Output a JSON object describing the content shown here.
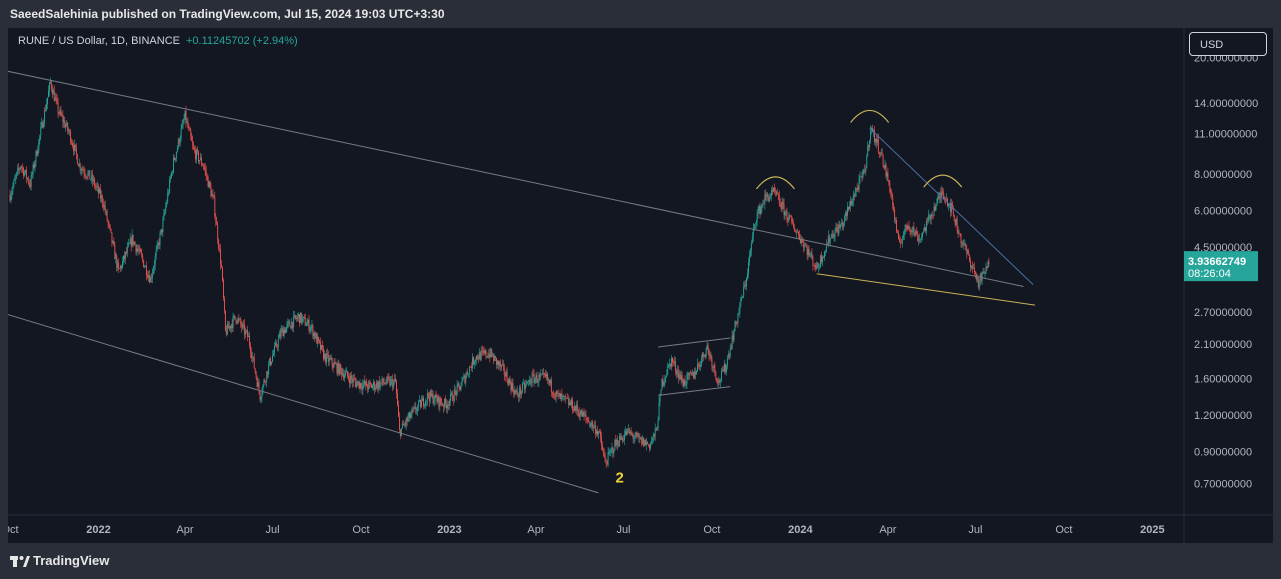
{
  "header": {
    "published_by": "SaeedSalehinia published on TradingView.com, Jul 15, 2024 19:03 UTC+3:30"
  },
  "legend": {
    "symbol": "RUNE / US Dollar, 1D, BINANCE",
    "change": "+0.11245702 (+2.94%)"
  },
  "currency_button": "USD",
  "footer": {
    "brand": "TradingView"
  },
  "chart_data": {
    "type": "candlestick",
    "symbol": "RUNE / US Dollar",
    "interval": "1D",
    "exchange": "BINANCE",
    "y_scale": "log",
    "ylim": [
      0.6,
      23
    ],
    "y_ticks": [
      {
        "value": 20,
        "label": "20.00000000"
      },
      {
        "value": 14,
        "label": "14.00000000"
      },
      {
        "value": 11,
        "label": "11.00000000"
      },
      {
        "value": 8,
        "label": "8.00000000"
      },
      {
        "value": 6,
        "label": "6.00000000"
      },
      {
        "value": 4.5,
        "label": "4.50000000"
      },
      {
        "value": 2.7,
        "label": "2.70000000"
      },
      {
        "value": 2.1,
        "label": "2.10000000"
      },
      {
        "value": 1.6,
        "label": "1.60000000"
      },
      {
        "value": 1.2,
        "label": "1.20000000"
      },
      {
        "value": 0.9,
        "label": "0.90000000"
      },
      {
        "value": 0.7,
        "label": "0.70000000"
      }
    ],
    "x_ticks": [
      {
        "date": "2021-10-01",
        "label": "Oct",
        "bold": false
      },
      {
        "date": "2022-01-01",
        "label": "2022",
        "bold": true
      },
      {
        "date": "2022-04-01",
        "label": "Apr",
        "bold": false
      },
      {
        "date": "2022-07-01",
        "label": "Jul",
        "bold": false
      },
      {
        "date": "2022-10-01",
        "label": "Oct",
        "bold": false
      },
      {
        "date": "2023-01-01",
        "label": "2023",
        "bold": true
      },
      {
        "date": "2023-04-01",
        "label": "Apr",
        "bold": false
      },
      {
        "date": "2023-07-01",
        "label": "Jul",
        "bold": false
      },
      {
        "date": "2023-10-01",
        "label": "Oct",
        "bold": false
      },
      {
        "date": "2024-01-01",
        "label": "2024",
        "bold": true
      },
      {
        "date": "2024-04-01",
        "label": "Apr",
        "bold": false
      },
      {
        "date": "2024-07-01",
        "label": "Jul",
        "bold": false
      },
      {
        "date": "2024-10-01",
        "label": "Oct",
        "bold": false
      },
      {
        "date": "2025-01-01",
        "label": "2025",
        "bold": true
      }
    ],
    "x_range": [
      "2021-10-01",
      "2025-02-05"
    ],
    "price_path": [
      [
        "2021-10-01",
        6.8
      ],
      [
        "2021-10-12",
        8.6
      ],
      [
        "2021-10-22",
        7.4
      ],
      [
        "2021-11-06",
        13.0
      ],
      [
        "2021-11-12",
        16.5
      ],
      [
        "2021-11-20",
        13.2
      ],
      [
        "2021-12-02",
        11.0
      ],
      [
        "2021-12-12",
        8.6
      ],
      [
        "2021-12-26",
        7.6
      ],
      [
        "2022-01-06",
        6.4
      ],
      [
        "2022-01-22",
        3.7
      ],
      [
        "2022-02-05",
        4.8
      ],
      [
        "2022-02-14",
        4.2
      ],
      [
        "2022-02-24",
        3.5
      ],
      [
        "2022-03-08",
        5.2
      ],
      [
        "2022-03-20",
        8.8
      ],
      [
        "2022-04-01",
        12.6
      ],
      [
        "2022-04-10",
        9.6
      ],
      [
        "2022-04-20",
        8.6
      ],
      [
        "2022-05-01",
        6.4
      ],
      [
        "2022-05-09",
        3.8
      ],
      [
        "2022-05-13",
        2.3
      ],
      [
        "2022-05-24",
        2.6
      ],
      [
        "2022-06-06",
        2.2
      ],
      [
        "2022-06-18",
        1.4
      ],
      [
        "2022-06-28",
        1.8
      ],
      [
        "2022-07-10",
        2.3
      ],
      [
        "2022-07-28",
        2.6
      ],
      [
        "2022-08-10",
        2.4
      ],
      [
        "2022-08-24",
        1.9
      ],
      [
        "2022-09-10",
        1.7
      ],
      [
        "2022-09-25",
        1.55
      ],
      [
        "2022-10-10",
        1.5
      ],
      [
        "2022-10-25",
        1.55
      ],
      [
        "2022-11-06",
        1.55
      ],
      [
        "2022-11-10",
        1.05
      ],
      [
        "2022-11-22",
        1.2
      ],
      [
        "2022-12-10",
        1.4
      ],
      [
        "2022-12-28",
        1.3
      ],
      [
        "2023-01-12",
        1.5
      ],
      [
        "2023-01-28",
        1.9
      ],
      [
        "2023-02-12",
        1.95
      ],
      [
        "2023-02-26",
        1.7
      ],
      [
        "2023-03-12",
        1.4
      ],
      [
        "2023-03-28",
        1.6
      ],
      [
        "2023-04-12",
        1.6
      ],
      [
        "2023-04-22",
        1.4
      ],
      [
        "2023-05-08",
        1.3
      ],
      [
        "2023-05-25",
        1.15
      ],
      [
        "2023-06-05",
        1.05
      ],
      [
        "2023-06-12",
        0.82
      ],
      [
        "2023-06-22",
        0.95
      ],
      [
        "2023-07-05",
        1.05
      ],
      [
        "2023-07-18",
        0.98
      ],
      [
        "2023-07-28",
        0.95
      ],
      [
        "2023-08-04",
        1.05
      ],
      [
        "2023-08-10",
        1.55
      ],
      [
        "2023-08-20",
        1.85
      ],
      [
        "2023-09-01",
        1.55
      ],
      [
        "2023-09-12",
        1.65
      ],
      [
        "2023-09-26",
        2.05
      ],
      [
        "2023-10-08",
        1.55
      ],
      [
        "2023-10-15",
        1.75
      ],
      [
        "2023-10-25",
        2.4
      ],
      [
        "2023-11-05",
        3.4
      ],
      [
        "2023-11-15",
        5.6
      ],
      [
        "2023-11-25",
        6.6
      ],
      [
        "2023-12-05",
        6.9
      ],
      [
        "2023-12-15",
        6.0
      ],
      [
        "2023-12-25",
        5.3
      ],
      [
        "2024-01-05",
        4.6
      ],
      [
        "2024-01-18",
        3.8
      ],
      [
        "2024-02-01",
        4.9
      ],
      [
        "2024-02-14",
        5.4
      ],
      [
        "2024-02-24",
        6.6
      ],
      [
        "2024-03-08",
        8.2
      ],
      [
        "2024-03-14",
        11.5
      ],
      [
        "2024-03-24",
        9.6
      ],
      [
        "2024-04-04",
        7.0
      ],
      [
        "2024-04-12",
        4.6
      ],
      [
        "2024-04-22",
        5.4
      ],
      [
        "2024-05-04",
        4.8
      ],
      [
        "2024-05-20",
        6.2
      ],
      [
        "2024-05-28",
        7.0
      ],
      [
        "2024-06-06",
        6.1
      ],
      [
        "2024-06-16",
        4.8
      ],
      [
        "2024-06-26",
        4.0
      ],
      [
        "2024-07-04",
        3.4
      ],
      [
        "2024-07-09",
        3.6
      ],
      [
        "2024-07-15",
        3.94
      ]
    ],
    "trendlines": [
      {
        "name": "channel-upper",
        "color": "#787b86",
        "from": [
          "2021-09-28",
          18.0
        ],
        "to": [
          "2024-08-20",
          3.3
        ]
      },
      {
        "name": "channel-lower",
        "color": "#787b86",
        "from": [
          "2021-09-28",
          2.65
        ],
        "to": [
          "2023-06-05",
          0.65
        ]
      },
      {
        "name": "flag-upper",
        "color": "#787b86",
        "from": [
          "2023-08-06",
          2.05
        ],
        "to": [
          "2023-10-20",
          2.2
        ]
      },
      {
        "name": "flag-lower",
        "color": "#787b86",
        "from": [
          "2023-08-06",
          1.4
        ],
        "to": [
          "2023-10-20",
          1.5
        ]
      },
      {
        "name": "neckline",
        "color": "#c9b458",
        "from": [
          "2024-01-18",
          3.65
        ],
        "to": [
          "2024-09-01",
          2.85
        ]
      },
      {
        "name": "descending-resistance",
        "color": "#4a6fa5",
        "from": [
          "2024-03-13",
          11.5
        ],
        "to": [
          "2024-08-30",
          3.35
        ]
      }
    ],
    "arcs": [
      {
        "name": "left-shoulder-arc",
        "color": "#c9b458",
        "center": [
          "2023-12-06",
          7.35
        ]
      },
      {
        "name": "head-arc",
        "color": "#c9b458",
        "center": [
          "2024-03-13",
          12.4
        ]
      },
      {
        "name": "right-shoulder-arc",
        "color": "#c9b458",
        "center": [
          "2024-05-28",
          7.45
        ]
      }
    ],
    "annotations": [
      {
        "text": "2",
        "color": "#f0d43a",
        "date": "2023-07-01",
        "price": 0.74
      }
    ],
    "last_price": {
      "label": "3.93662749",
      "countdown": "08:26:04",
      "value": 3.93662749,
      "color": "#26a69a"
    },
    "colors": {
      "up": "#26a69a",
      "down": "#ef5350",
      "background": "#131722",
      "grid": "#1e222d",
      "axis_text": "#b2b5be"
    }
  }
}
